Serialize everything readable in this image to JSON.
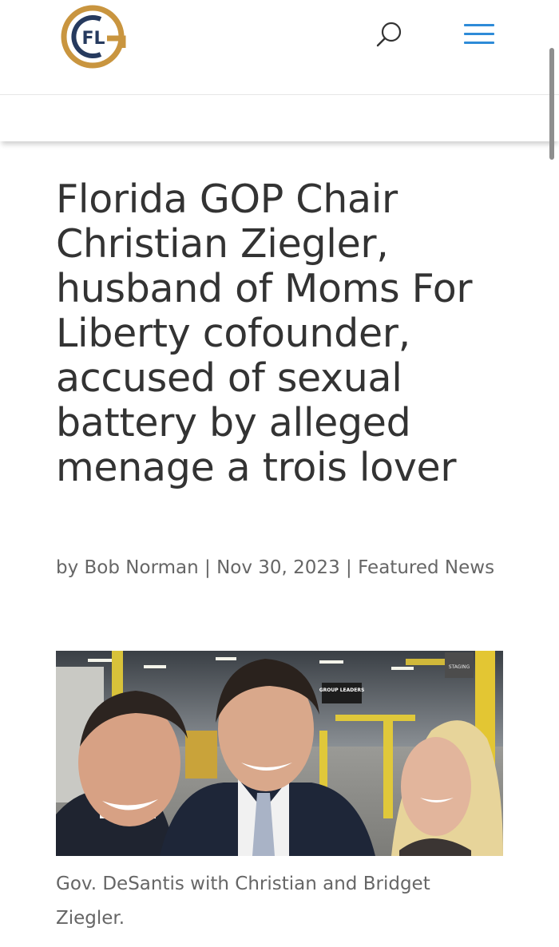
{
  "header": {
    "logo_text": "FL",
    "logo_colors": {
      "ring": "#c9953f",
      "letters": "#263a5e"
    },
    "search_icon": "search-icon",
    "menu_icon": "hamburger-menu-icon",
    "accent_color": "#2e8bd8"
  },
  "article": {
    "title": "Florida GOP Chair Christian Ziegler, husband of Moms For Liberty cofounder, accused of sexual battery by alleged menage a trois lover",
    "meta": {
      "by_prefix": "by ",
      "author": "Bob Norman",
      "separator": " | ",
      "date": "Nov 30, 2023",
      "category": "Featured News"
    },
    "photo": {
      "sign_1": "GROUP LEADERS",
      "sign_2": "STAGING"
    },
    "caption": "Gov. DeSantis with Christian and Bridget Ziegler."
  }
}
